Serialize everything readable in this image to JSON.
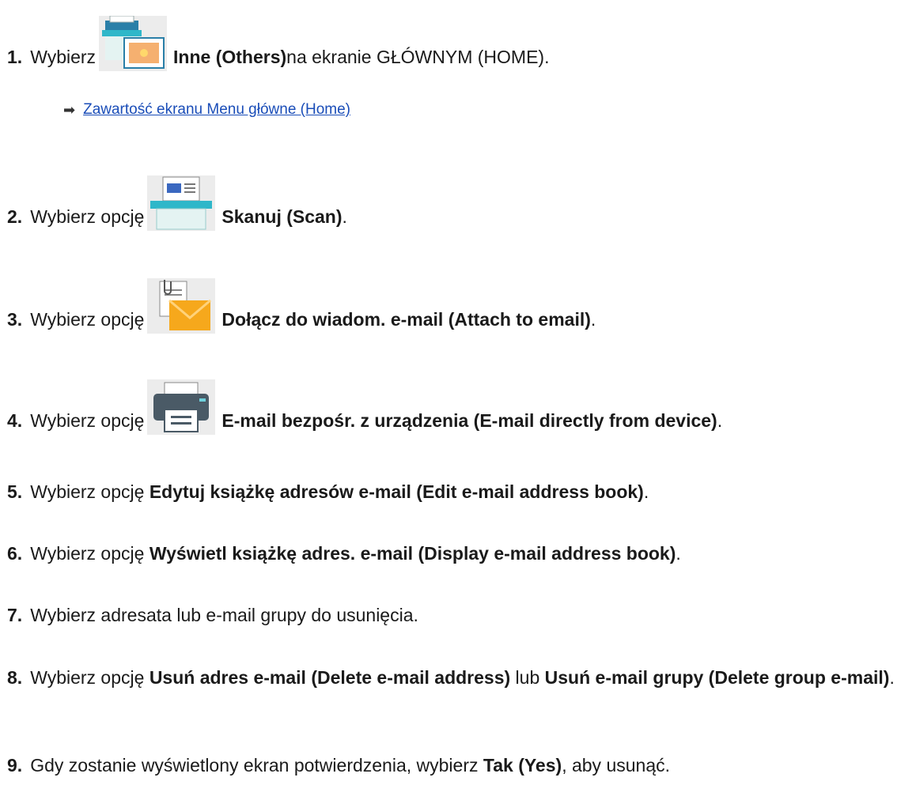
{
  "steps": [
    {
      "num": "1.",
      "pre": "Wybierz",
      "bold": "Inne (Others)",
      "post": " na ekranie GŁÓWNYM (HOME).",
      "icon": "others-icon"
    },
    {
      "num": "2.",
      "pre": "Wybierz opcję",
      "bold": "Skanuj (Scan)",
      "post": ".",
      "icon": "scan-icon"
    },
    {
      "num": "3.",
      "pre": "Wybierz opcję",
      "bold": "Dołącz do wiadom. e-mail (Attach to email)",
      "post": ".",
      "icon": "attach-email-icon"
    },
    {
      "num": "4.",
      "pre": "Wybierz opcję",
      "bold": "E-mail bezpośr. z urządzenia (E-mail directly from device)",
      "post": ".",
      "icon": "printer-icon"
    },
    {
      "num": "5.",
      "pre": "Wybierz opcję ",
      "bold": "Edytuj książkę adresów e-mail (Edit e-mail address book)",
      "post": "."
    },
    {
      "num": "6.",
      "pre": "Wybierz opcję ",
      "bold": "Wyświetl książkę adres. e-mail (Display e-mail address book)",
      "post": "."
    },
    {
      "num": "7.",
      "pre": "Wybierz adresata lub e-mail grupy do usunięcia.",
      "bold": "",
      "post": ""
    },
    {
      "num": "8.",
      "pre": "Wybierz opcję ",
      "bold": "Usuń adres e-mail (Delete e-mail address)",
      "mid": " lub ",
      "bold2": "Usuń e-mail grupy (Delete group e-mail)",
      "post": "."
    },
    {
      "num": "9.",
      "pre": "Gdy zostanie wyświetlony ekran potwierdzenia, wybierz ",
      "bold": "Tak (Yes)",
      "post": ", aby usunąć."
    }
  ],
  "link": {
    "label": "Zawartość ekranu Menu główne (Home)",
    "color": "#1a4db8"
  }
}
